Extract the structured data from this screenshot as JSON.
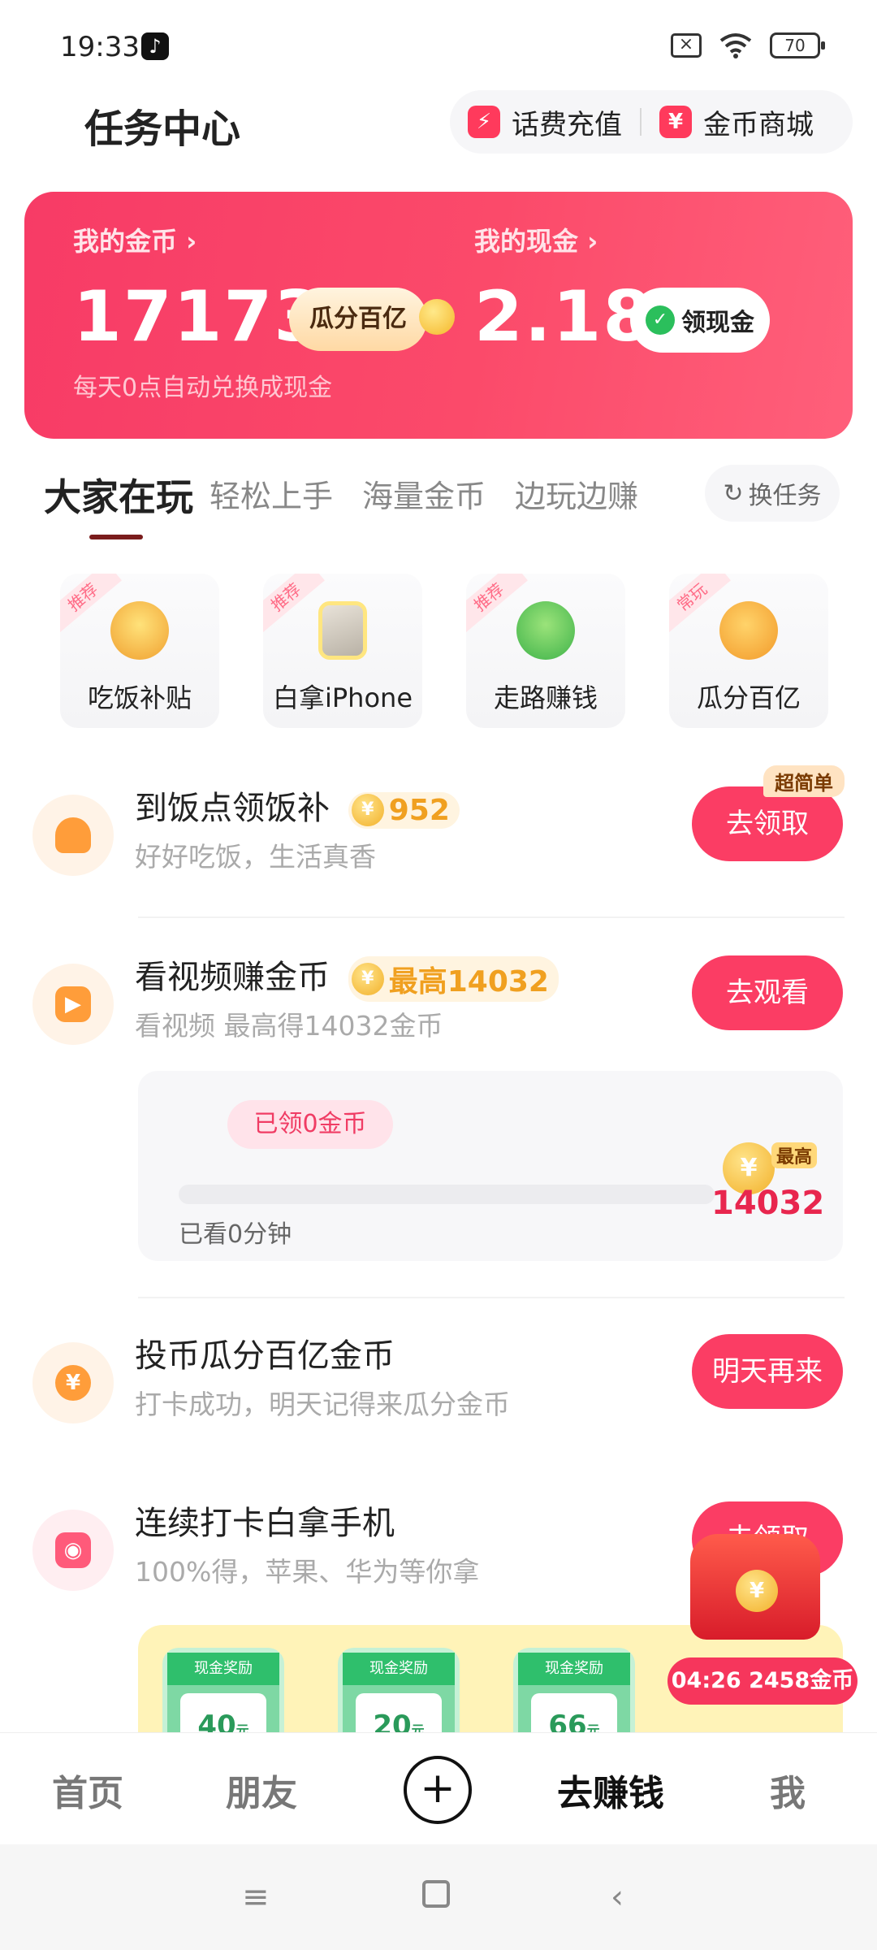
{
  "status": {
    "time": "19:33",
    "battery": "70"
  },
  "header": {
    "title": "任务中心",
    "actions": [
      {
        "label": "话费充值",
        "icon": "lightning-icon",
        "glyph": "⚡"
      },
      {
        "label": "金币商城",
        "icon": "yen-store-icon",
        "glyph": "¥"
      }
    ]
  },
  "balance": {
    "coins_label": "我的金币 ›",
    "coins_value": "17173",
    "guafen_tag": "瓜分百亿",
    "cash_label": "我的现金 ›",
    "cash_value": "2.18",
    "cash_button": "领现金",
    "note": "每天0点自动兑换成现金"
  },
  "tabs": {
    "items": [
      "大家在玩",
      "轻松上手",
      "海量金币",
      "边玩边赚"
    ],
    "active_index": 0,
    "swap_label": "换任务"
  },
  "games": [
    {
      "label": "吃饭补贴",
      "ribbon": "推荐",
      "icon": "noodle-bowl-icon"
    },
    {
      "label": "白拿iPhone",
      "ribbon": "推荐",
      "icon": "iphone-icon"
    },
    {
      "label": "走路赚钱",
      "ribbon": "推荐",
      "icon": "running-person-icon"
    },
    {
      "label": "瓜分百亿",
      "ribbon": "常玩",
      "icon": "coin-hand-icon"
    }
  ],
  "tasks": [
    {
      "title": "到饭点领饭补",
      "coin": "952",
      "desc": "好好吃饭，生活真香",
      "button": "去领取",
      "tag": "超简单"
    },
    {
      "title": "看视频赚金币",
      "coin": "最高14032",
      "desc": "看视频 最高得14032金币",
      "button": "去观看"
    },
    {
      "title": "投币瓜分百亿金币",
      "desc": "打卡成功，明天记得来瓜分金币",
      "button": "明天再来"
    },
    {
      "title": "连续打卡白拿手机",
      "desc": "100%得，苹果、华为等你拿",
      "button": "去领取"
    }
  ],
  "video_progress": {
    "collected": "已领0金币",
    "watched": "已看0分钟",
    "max_tag": "最高",
    "max_value": "14032",
    "progress_fraction": 0
  },
  "prizes": [
    {
      "head": "现金奖励",
      "value": "40",
      "unit": "元"
    },
    {
      "head": "现金奖励",
      "value": "20",
      "unit": "元"
    },
    {
      "head": "现金奖励",
      "value": "66",
      "unit": "元"
    }
  ],
  "floating": {
    "timer": "04:26 2458金币"
  },
  "bottom_nav": {
    "items": [
      "首页",
      "朋友",
      "+",
      "去赚钱",
      "我"
    ],
    "active": "去赚钱"
  },
  "colors": {
    "accent": "#fb3d64",
    "coin": "#f2b02a",
    "tab_underline": "#7a1c1c"
  }
}
